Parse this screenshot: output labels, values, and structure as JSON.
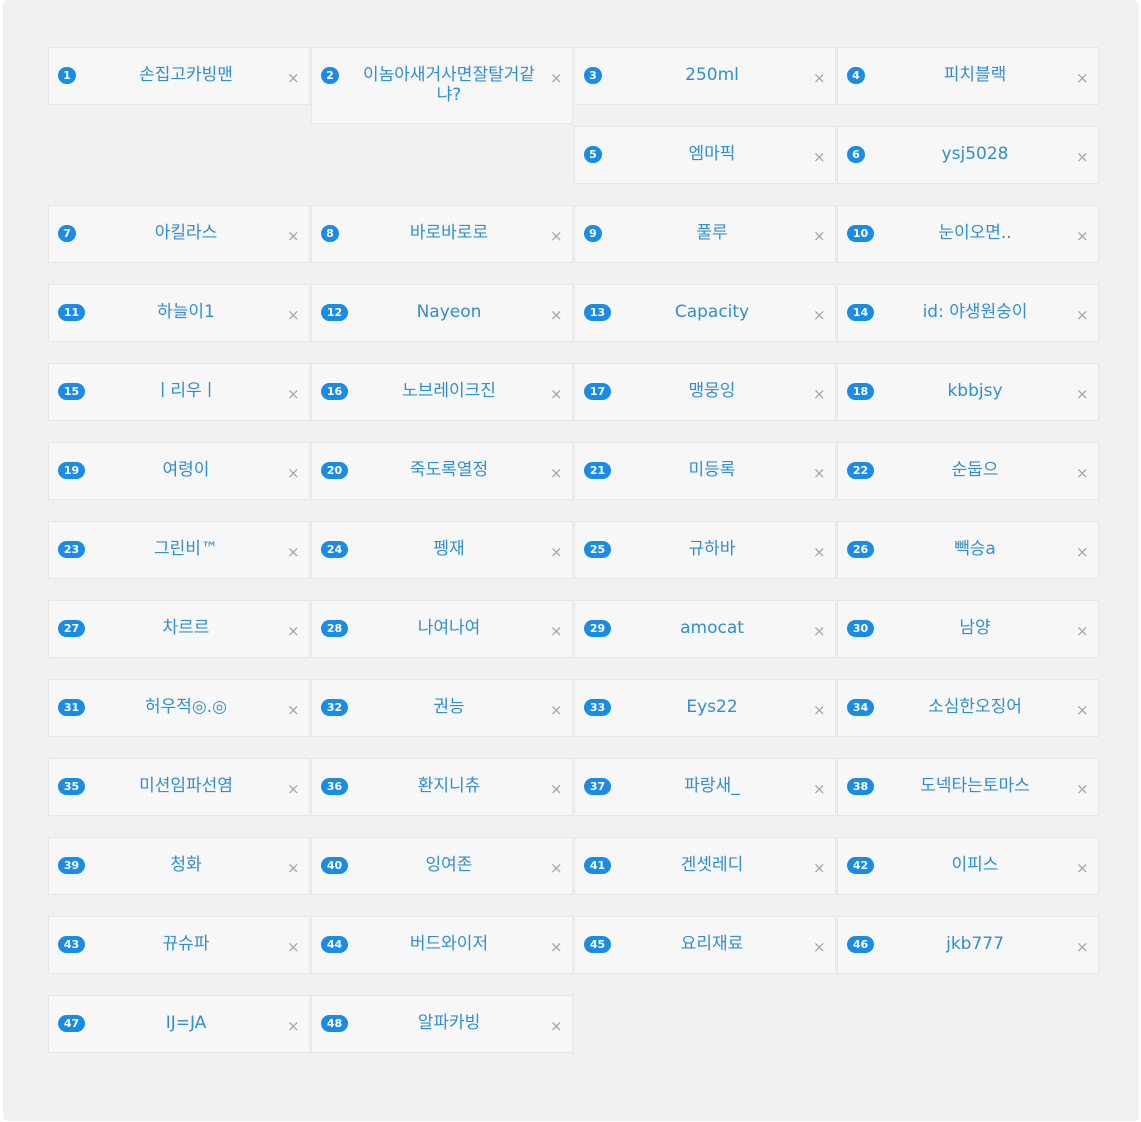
{
  "close_glyph": "×",
  "colors": {
    "badge": "#1a8ce4",
    "name_text": "#2f8fd3",
    "chip_background": "#f7f7f7",
    "panel_background": "#f1f1f1",
    "close_icon": "#a3a3a3"
  },
  "items": [
    {
      "num": "1",
      "name": "손집고카빙맨"
    },
    {
      "num": "2",
      "name": "이놈아새거사면잘탈거같냐?"
    },
    {
      "num": "3",
      "name": "250ml"
    },
    {
      "num": "4",
      "name": "피치블랙"
    },
    {
      "num": "5",
      "name": "엠마픽"
    },
    {
      "num": "6",
      "name": "ysj5028"
    },
    {
      "num": "7",
      "name": "아킬라스"
    },
    {
      "num": "8",
      "name": "바로바로로"
    },
    {
      "num": "9",
      "name": "풀루"
    },
    {
      "num": "10",
      "name": "눈이오면.."
    },
    {
      "num": "11",
      "name": "하늘이1"
    },
    {
      "num": "12",
      "name": "Nayeon"
    },
    {
      "num": "13",
      "name": "Capacity"
    },
    {
      "num": "14",
      "name": "id: 야생원숭이"
    },
    {
      "num": "15",
      "name": "ㅣ리우ㅣ"
    },
    {
      "num": "16",
      "name": "노브레이크진"
    },
    {
      "num": "17",
      "name": "맹뭉잉"
    },
    {
      "num": "18",
      "name": "kbbjsy"
    },
    {
      "num": "19",
      "name": "여령이"
    },
    {
      "num": "20",
      "name": "죽도록열정"
    },
    {
      "num": "21",
      "name": "미등록"
    },
    {
      "num": "22",
      "name": "순둡으"
    },
    {
      "num": "23",
      "name": "그린비™"
    },
    {
      "num": "24",
      "name": "펭재"
    },
    {
      "num": "25",
      "name": "규하바"
    },
    {
      "num": "26",
      "name": "빽승a"
    },
    {
      "num": "27",
      "name": "차르르"
    },
    {
      "num": "28",
      "name": "나여나여"
    },
    {
      "num": "29",
      "name": "amocat"
    },
    {
      "num": "30",
      "name": "남양"
    },
    {
      "num": "31",
      "name": "허우적◎.◎"
    },
    {
      "num": "32",
      "name": "권능"
    },
    {
      "num": "33",
      "name": "Eys22"
    },
    {
      "num": "34",
      "name": "소심한오징어"
    },
    {
      "num": "35",
      "name": "미션임파선염"
    },
    {
      "num": "36",
      "name": "환지니츄"
    },
    {
      "num": "37",
      "name": "파랑새_"
    },
    {
      "num": "38",
      "name": "도넥타는토마스"
    },
    {
      "num": "39",
      "name": "청화"
    },
    {
      "num": "40",
      "name": "잉여존"
    },
    {
      "num": "41",
      "name": "겐셋레디"
    },
    {
      "num": "42",
      "name": "이피스"
    },
    {
      "num": "43",
      "name": "뀨슈파"
    },
    {
      "num": "44",
      "name": "버드와이저"
    },
    {
      "num": "45",
      "name": "요리재료"
    },
    {
      "num": "46",
      "name": "jkb777"
    },
    {
      "num": "47",
      "name": "IJ=JA"
    },
    {
      "num": "48",
      "name": "알파카빙"
    }
  ]
}
